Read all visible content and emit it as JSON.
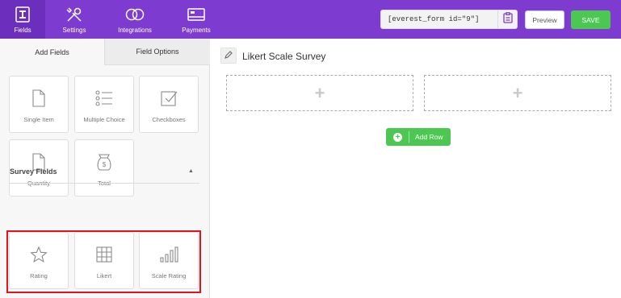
{
  "nav": [
    {
      "label": "Fields",
      "icon": "fields-icon"
    },
    {
      "label": "Settings",
      "icon": "settings-icon"
    },
    {
      "label": "Integrations",
      "icon": "integrations-icon"
    },
    {
      "label": "Payments",
      "icon": "payments-icon"
    }
  ],
  "toolbar": {
    "shortcode": "[everest_form id=\"9\"]",
    "copy_icon": "clipboard-icon",
    "preview_label": "Preview",
    "save_label": "SAVE"
  },
  "tabs": {
    "add_fields": "Add Fields",
    "field_options": "Field Options"
  },
  "fields": [
    {
      "label": "Single Item",
      "icon": "document-icon"
    },
    {
      "label": "Multiple Choice",
      "icon": "list-icon"
    },
    {
      "label": "Checkboxes",
      "icon": "checkbox-icon"
    },
    {
      "label": "Quantity",
      "icon": "document-icon"
    },
    {
      "label": "Total",
      "icon": "money-bag-icon"
    }
  ],
  "survey": {
    "title": "Survey Fields",
    "items": [
      {
        "label": "Rating",
        "icon": "star-icon"
      },
      {
        "label": "Likert",
        "icon": "grid-icon"
      },
      {
        "label": "Scale Rating",
        "icon": "bar-chart-icon"
      }
    ]
  },
  "form": {
    "title": "Likert Scale Survey",
    "add_row_label": "Add Row"
  },
  "colors": {
    "topbar": "#7e3bd0",
    "accent_green": "#4cc752",
    "highlight_red": "#e0151b"
  }
}
